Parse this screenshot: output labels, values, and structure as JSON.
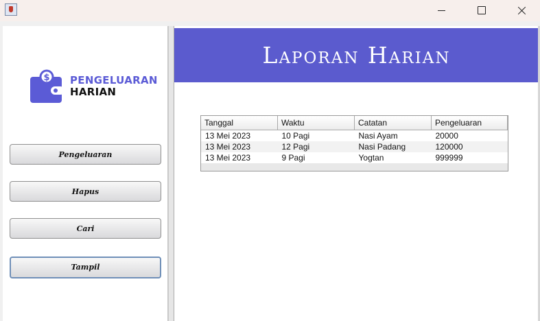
{
  "window": {
    "controls": {
      "minimize": "minimize-icon",
      "maximize": "maximize-icon",
      "close": "close-icon"
    }
  },
  "sidebar": {
    "logo": {
      "line1": "PENGELUARAN",
      "line2": "HARIAN",
      "icon": "wallet-icon",
      "accent": "#5b5bd6"
    },
    "buttons": [
      {
        "label": "Pengeluaran"
      },
      {
        "label": "Hapus"
      },
      {
        "label": "Cari"
      },
      {
        "label": "Tampil"
      }
    ]
  },
  "main": {
    "title": "Laporan Harian",
    "header_color": "#5b5bce",
    "table": {
      "columns": [
        "Tanggal",
        "Waktu",
        "Catatan",
        "Pengeluaran"
      ],
      "rows": [
        [
          "13 Mei 2023",
          "10 Pagi",
          "Nasi Ayam",
          "20000"
        ],
        [
          "13 Mei 2023",
          "12 Pagi",
          "Nasi Padang",
          "120000"
        ],
        [
          "13 Mei 2023",
          "9 Pagi",
          "Yogtan",
          "999999"
        ]
      ]
    }
  }
}
